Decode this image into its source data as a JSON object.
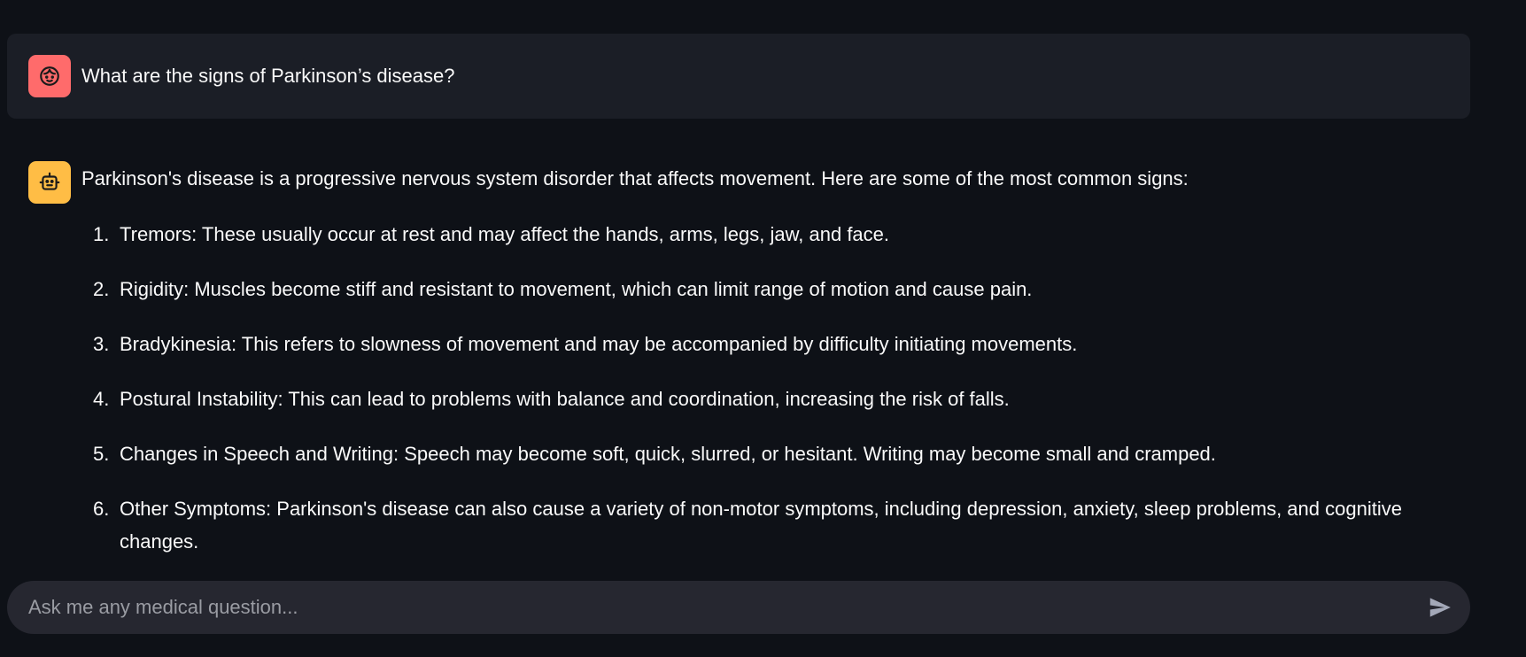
{
  "user_message": {
    "avatar_icon": "user-face-icon",
    "avatar_color": "#ff6b6b",
    "text": "What are the signs of Parkinson’s disease?"
  },
  "assistant_message": {
    "avatar_icon": "robot-icon",
    "avatar_color": "#ffbd45",
    "intro": "Parkinson's disease is a progressive nervous system disorder that affects movement. Here are some of the most common signs:",
    "items": [
      {
        "num": "1.",
        "text": "Tremors: These usually occur at rest and may affect the hands, arms, legs, jaw, and face."
      },
      {
        "num": "2.",
        "text": "Rigidity: Muscles become stiff and resistant to movement, which can limit range of motion and cause pain."
      },
      {
        "num": "3.",
        "text": "Bradykinesia: This refers to slowness of movement and may be accompanied by difficulty initiating movements."
      },
      {
        "num": "4.",
        "text": "Postural Instability: This can lead to problems with balance and coordination, increasing the risk of falls."
      },
      {
        "num": "5.",
        "text": "Changes in Speech and Writing: Speech may become soft, quick, slurred, or hesitant. Writing may become small and cramped."
      },
      {
        "num": "6.",
        "text": "Other Symptoms: Parkinson's disease can also cause a variety of non-motor symptoms, including depression, anxiety, sleep problems, and cognitive changes."
      }
    ]
  },
  "chat_input": {
    "placeholder": "Ask me any medical question...",
    "value": "",
    "send_icon": "send-icon"
  },
  "colors": {
    "background": "#0e1117",
    "user_bubble": "#1b1e26",
    "input_background": "#262730"
  }
}
